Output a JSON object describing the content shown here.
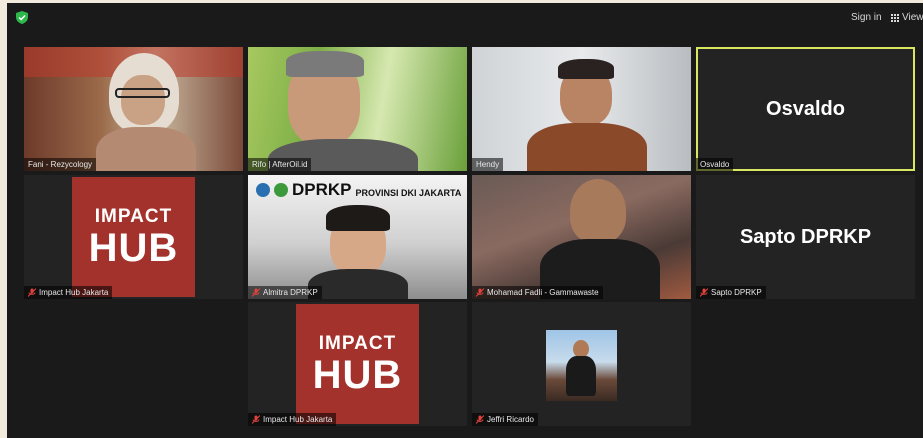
{
  "topbar": {
    "sign_in_label": "Sign in",
    "view_label": "View",
    "security_icon": "shield-check-icon",
    "view_icon": "grid-view-icon"
  },
  "tiles": {
    "fani": {
      "name": "Fani - Rezycology"
    },
    "rifo": {
      "name": "Rifo | AfterOil.id"
    },
    "hendy": {
      "name": "Hendy"
    },
    "osvaldo": {
      "name": "Osvaldo",
      "display": "Osvaldo",
      "active_speaker": true
    },
    "impact_hub_1": {
      "name": "Impact Hub Jakarta",
      "logo_line1": "IMPACT",
      "logo_line2": "HUB",
      "muted": true
    },
    "almitra": {
      "name": "Almitra DPRKP",
      "banner_logo": "DPRKP",
      "banner_sub": "PROVINSI DKI JAKARTA",
      "muted": true
    },
    "fadli": {
      "name": "Mohamad Fadli - Gammawaste",
      "muted": true
    },
    "sapto": {
      "name": "Sapto DPRKP",
      "display": "Sapto DPRKP",
      "muted": true
    },
    "impact_hub_2": {
      "name": "Impact Hub Jakarta",
      "logo_line1": "IMPACT",
      "logo_line2": "HUB",
      "muted": true
    },
    "jeffri": {
      "name": "Jeffri Ricardo",
      "muted": true
    }
  },
  "colors": {
    "background": "#1a1a1a",
    "tile": "#232323",
    "active_border": "#d8e660",
    "impact_hub_red": "#a3322c",
    "muted_mic": "#e0433a",
    "secure_green": "#2eb84b"
  }
}
